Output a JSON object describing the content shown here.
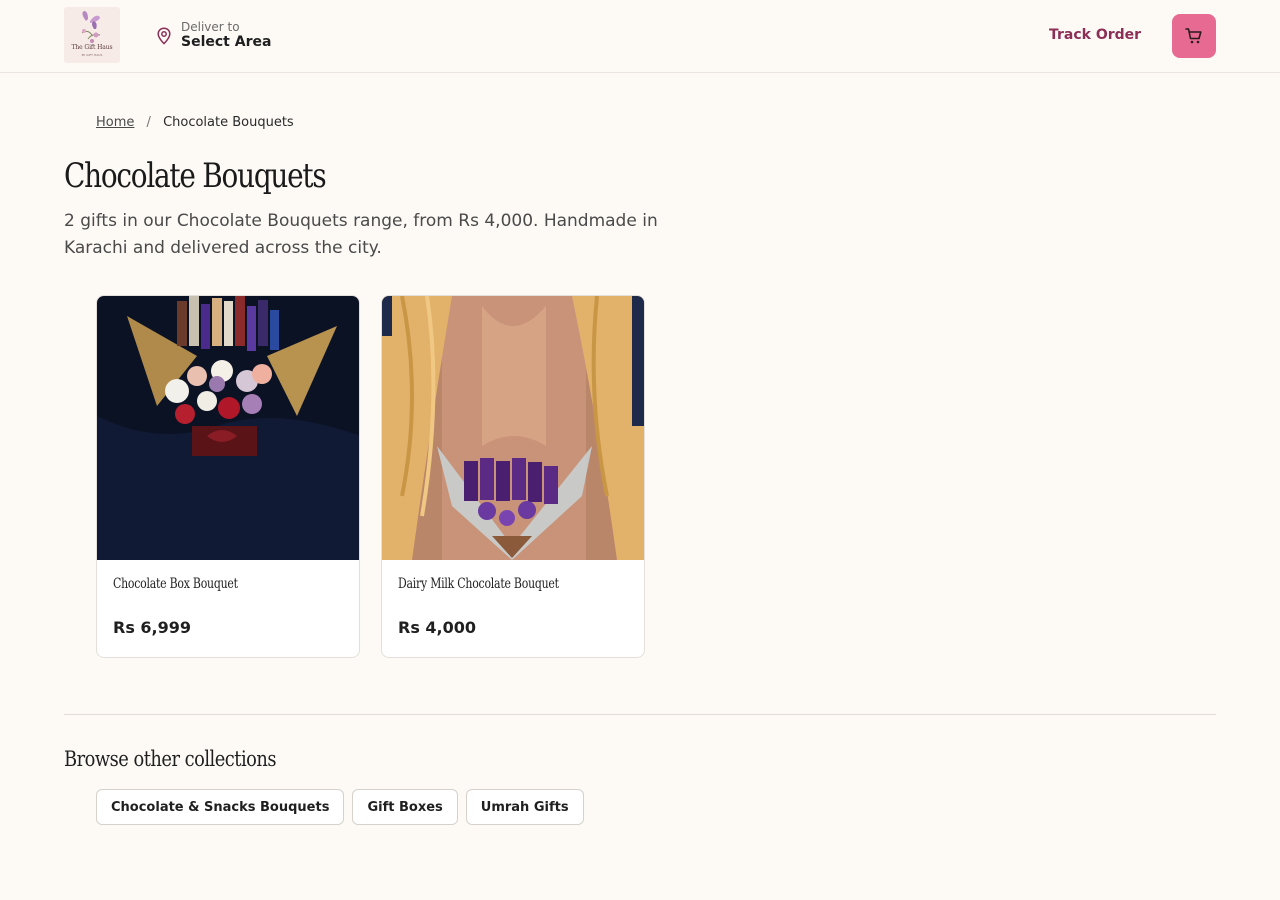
{
  "header": {
    "logo": {
      "text": "The Gift Haus",
      "sub": "BY GIFT HAUS"
    },
    "deliver": {
      "label": "Deliver to",
      "value": "Select Area"
    },
    "track_label": "Track Order"
  },
  "breadcrumb": {
    "home": "Home",
    "separator": "/",
    "current": "Chocolate Bouquets"
  },
  "page": {
    "title": "Chocolate Bouquets",
    "intro": "2 gifts in our Chocolate Bouquets range, from Rs 4,000. Handmade in Karachi and delivered across the city."
  },
  "products": [
    {
      "name": "Chocolate Box Bouquet",
      "price": "Rs 6,999"
    },
    {
      "name": "Dairy Milk Chocolate Bouquet",
      "price": "Rs 4,000"
    }
  ],
  "browse": {
    "title": "Browse other collections",
    "chips": [
      "Chocolate & Snacks Bouquets",
      "Gift Boxes",
      "Umrah Gifts"
    ]
  },
  "colors": {
    "accent": "#8c2f57",
    "cart": "#e76a92",
    "background": "#fdfaf6"
  },
  "icons": {
    "location": "map-pin-icon",
    "cart": "shopping-cart-icon"
  }
}
